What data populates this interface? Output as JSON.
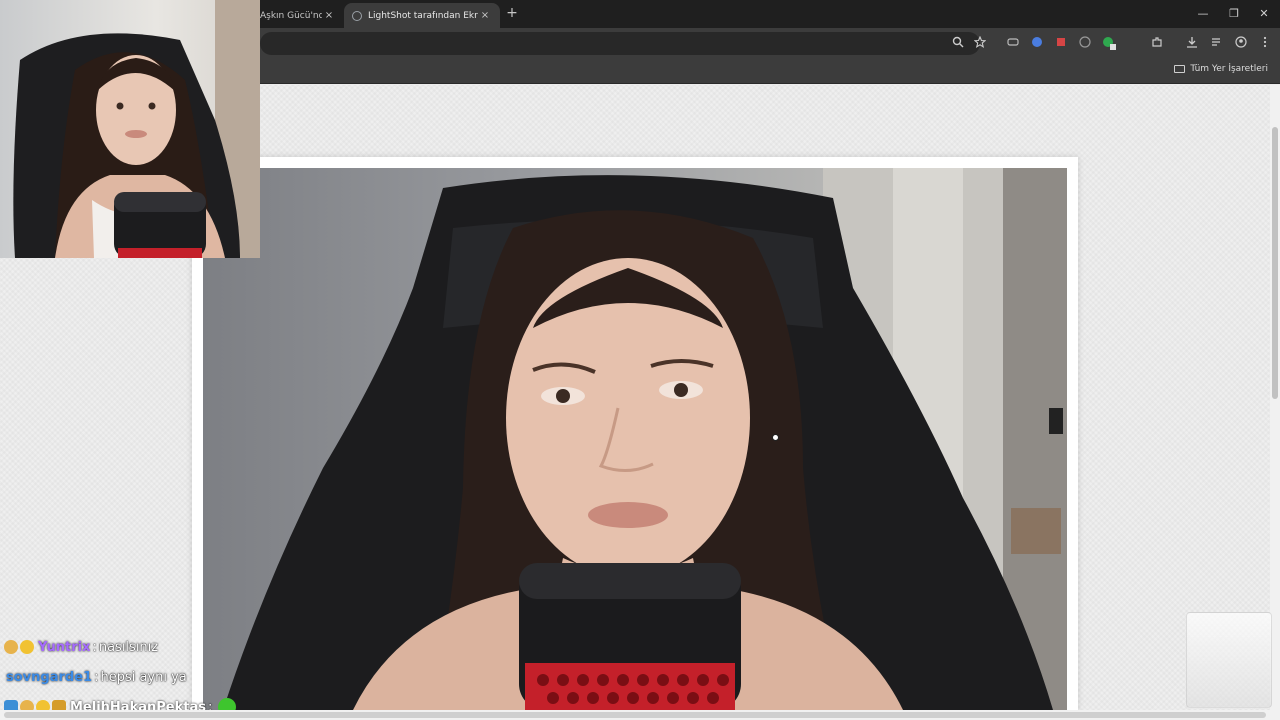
{
  "browser": {
    "tabs": [
      {
        "title": "Aşkın Gücü'nde",
        "active": false
      },
      {
        "title": "LightShot tarafından Ekran Gör",
        "active": true
      }
    ],
    "new_tab_label": "+",
    "close_label": "×",
    "window_controls": {
      "minimize": "—",
      "maximize": "❐",
      "close": "✕"
    },
    "toolbar_icons": [
      "zoom-icon",
      "bookmark-star-icon",
      "extension-icons",
      "download-icon",
      "media-icon",
      "profile-icon",
      "menu-icon"
    ],
    "bookmarks_folder": "Tüm Yer İşaretleri"
  },
  "chat": {
    "messages": [
      {
        "user": "Yuntrix",
        "user_color": "#a66bff",
        "separator": ":",
        "text": "nasılsınız"
      },
      {
        "user": "sovngarde1",
        "user_color": "#3b8be6",
        "separator": ":",
        "text": "hepsi aynı ya"
      },
      {
        "user": "MelihHakanPektas",
        "user_color": "#ffffff",
        "separator": ":",
        "text": ""
      }
    ]
  }
}
